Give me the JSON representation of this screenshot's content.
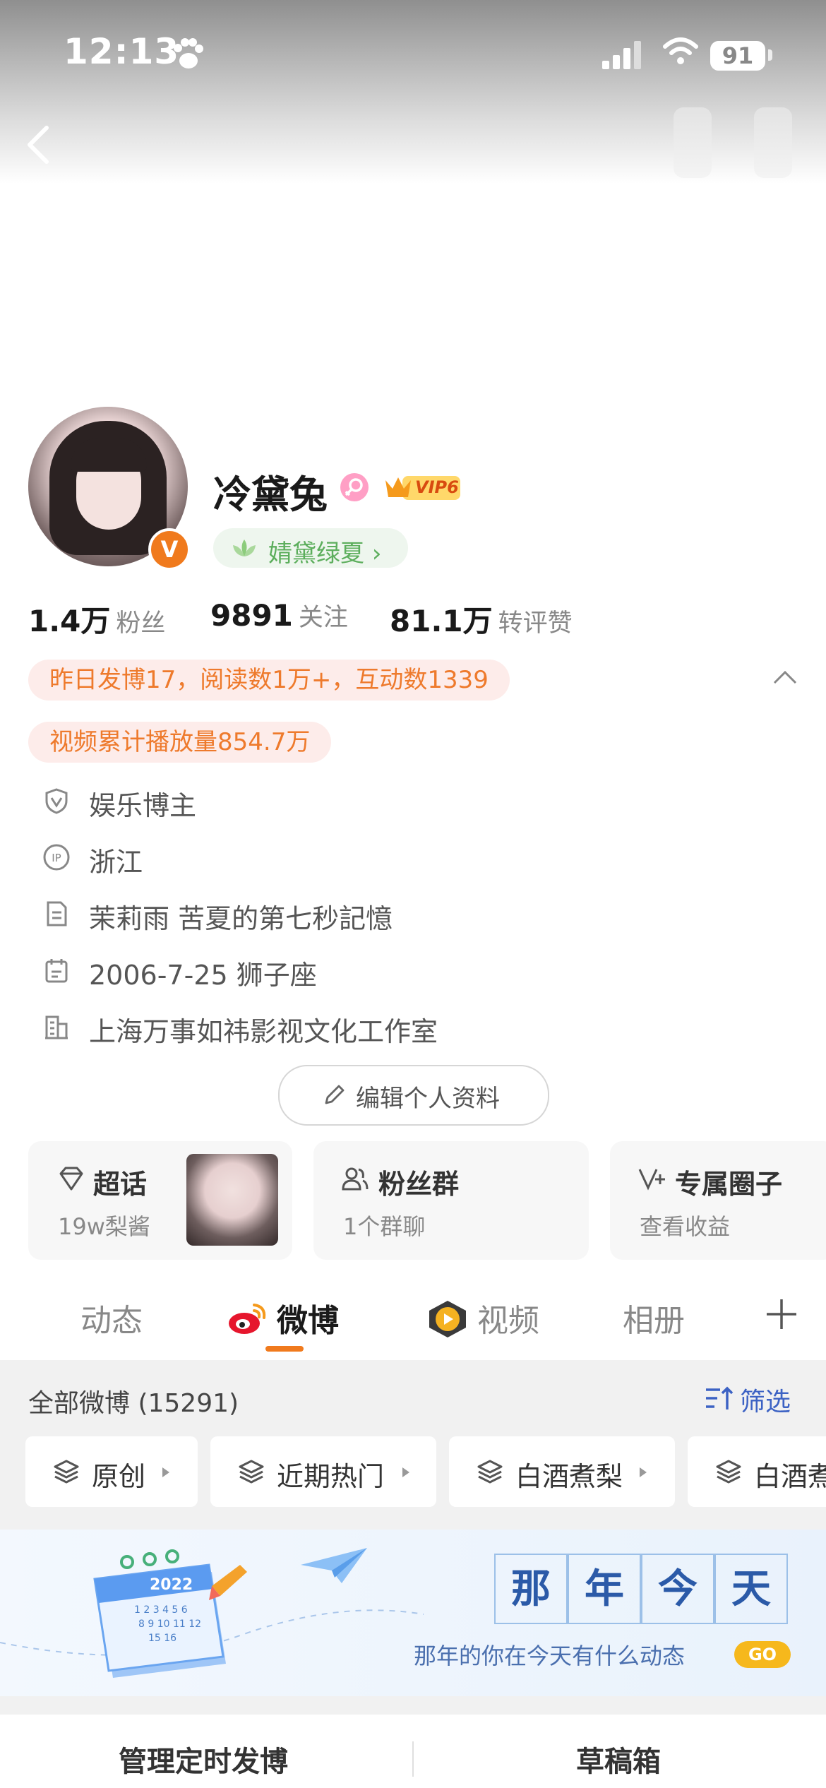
{
  "status_bar": {
    "time": "12:13",
    "battery": "91"
  },
  "profile": {
    "name": "冷黛兔",
    "vip_label": "VIP6",
    "verified_badge": "V",
    "tag": "婧黛绿夏",
    "tag_chevron": "›"
  },
  "stats": [
    {
      "value": "1.4万",
      "label": "粉丝"
    },
    {
      "value": "9891",
      "label": "关注"
    },
    {
      "value": "81.1万",
      "label": "转评赞"
    }
  ],
  "highlights": [
    "昨日发博17，阅读数1万+，互动数1339",
    "视频累计播放量854.7万"
  ],
  "info": [
    {
      "icon": "shield-v-icon",
      "text": "娱乐博主"
    },
    {
      "icon": "ip-icon",
      "text": "浙江"
    },
    {
      "icon": "document-icon",
      "text": "茉莉雨 苦夏的第七秒記憶"
    },
    {
      "icon": "calendar-icon",
      "text": "2006-7-25 狮子座"
    },
    {
      "icon": "building-icon",
      "text": "上海万事如祎影视文化工作室"
    }
  ],
  "edit_button": "编辑个人资料",
  "cards": [
    {
      "title": "超话",
      "subtitle": "19w梨酱",
      "icon": "diamond-icon"
    },
    {
      "title": "粉丝群",
      "subtitle": "1个群聊",
      "icon": "people-icon"
    },
    {
      "title": "专属圈子",
      "subtitle": "查看收益",
      "icon": "v-plus-icon"
    }
  ],
  "tabs": [
    "动态",
    "微博",
    "视频",
    "相册"
  ],
  "active_tab": "微博",
  "feed": {
    "all_label": "全部微博 (15291)",
    "filter_label": "筛选",
    "chips": [
      "原创",
      "近期热门",
      "白酒煮梨",
      "白酒煮"
    ]
  },
  "banner": {
    "calendar_year": "2022",
    "calendar_nums": "1 2 3 4 5 6",
    "calendar_nums2": "8 9 10 11 12",
    "calendar_nums3": "15 16",
    "title_chars": [
      "那",
      "年",
      "今",
      "天"
    ],
    "subtitle": "那年的你在今天有什么动态",
    "go": "GO"
  },
  "bottom": {
    "left": "管理定时发博",
    "right": "草稿箱"
  },
  "colors": {
    "accent_orange": "#f07a1d",
    "filter_blue": "#3c62c4",
    "tag_green": "#5cae5c"
  }
}
